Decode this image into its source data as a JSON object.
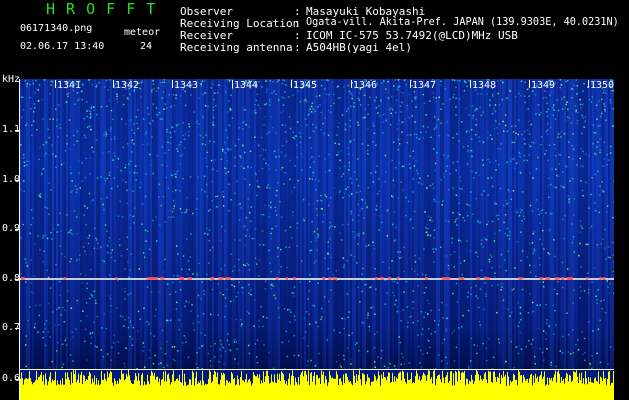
{
  "header": {
    "title": "H R O F F T",
    "filename": "06171340.png",
    "datetime": "02.06.17 13:40",
    "meteor_label": "meteor",
    "meteor_count": "24",
    "fields": [
      {
        "label": "Observer",
        "value": "Masayuki Kobayashi"
      },
      {
        "label": "Receiving Location",
        "value": "Ogata-vill. Akita-Pref. JAPAN (139.9303E, 40.0231N)"
      },
      {
        "label": "Receiver",
        "value": "ICOM IC-575 53.7492(@LCD)MHz USB"
      },
      {
        "label": "Receiving antenna",
        "value": "A504HB(yagi 4el)"
      }
    ],
    "colon": ":"
  },
  "axes": {
    "y_unit": "kHz",
    "y_labels": [
      "1.1",
      "1.0",
      "0.9",
      "0.8",
      "0.7",
      "0.6"
    ],
    "time_labels": [
      "1341",
      "1342",
      "1343",
      "1344",
      "1345",
      "1346",
      "1347",
      "1348",
      "1349",
      "1350"
    ]
  },
  "colors": {
    "background": "#000000",
    "title": "#22e022",
    "spectrum_base": "#0a2fa8",
    "carrier_line": "#e8e8e8",
    "strip_signal": "#ffff00"
  }
}
